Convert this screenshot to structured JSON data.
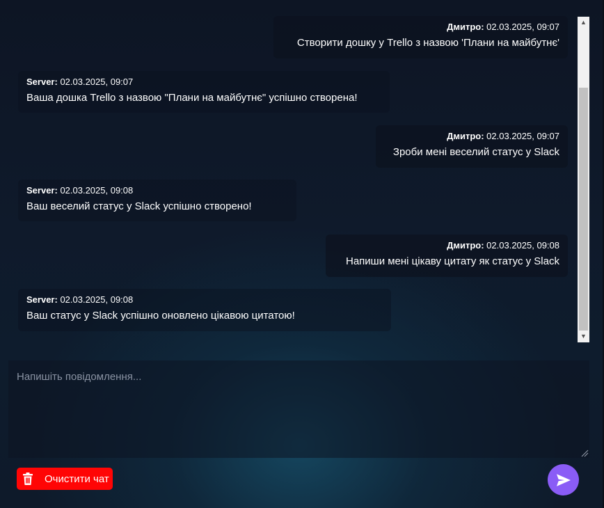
{
  "chat": {
    "messages": [
      {
        "author": "Дмитро:",
        "time": "02.03.2025, 09:07",
        "text": "Створити дошку у Trello з назвою 'Плани на майбутнє'",
        "role": "user"
      },
      {
        "author": "Server:",
        "time": "02.03.2025, 09:07",
        "text": "Ваша дошка Trello з назвою \"Плани на майбутнє\" успішно створена!",
        "role": "server"
      },
      {
        "author": "Дмитро:",
        "time": "02.03.2025, 09:07",
        "text": "Зроби мені веселий статус у Slack",
        "role": "user"
      },
      {
        "author": "Server:",
        "time": "02.03.2025, 09:08",
        "text": "Ваш веселий статус у Slack успішно створено!",
        "role": "server"
      },
      {
        "author": "Дмитро:",
        "time": "02.03.2025, 09:08",
        "text": "Напиши мені цікаву цитату як статус у Slack",
        "role": "user"
      },
      {
        "author": "Server:",
        "time": "02.03.2025, 09:08",
        "text": "Ваш статус у Slack успішно оновлено цікавою цитатою!",
        "role": "server"
      }
    ]
  },
  "composer": {
    "placeholder": "Напишіть повідомлення...",
    "value": ""
  },
  "actions": {
    "clear_label": "Очистити чат",
    "clear_icon": "trash-icon",
    "send_icon": "send-icon"
  },
  "colors": {
    "clear_button": "#ff0505",
    "send_button": "#8a5cf6",
    "background": "#0e1626"
  }
}
